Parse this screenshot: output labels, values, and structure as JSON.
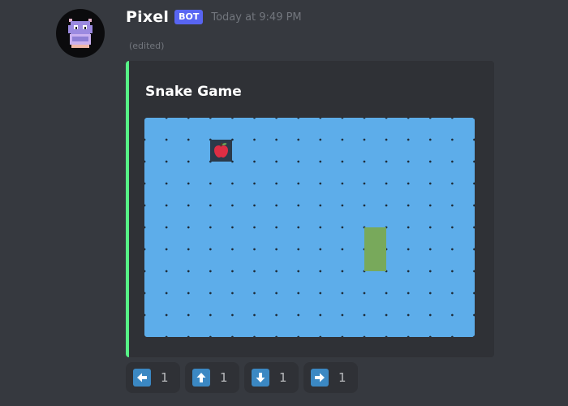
{
  "message": {
    "username": "Pixel",
    "bot_badge": "BOT",
    "timestamp": "Today at 9:49 PM",
    "edited": "(edited)",
    "avatar_icon": "pixel-monster-avatar"
  },
  "embed": {
    "accent_color": "#57f287",
    "title": "Snake Game",
    "board": {
      "columns": 15,
      "rows": 10,
      "background": "#5dadea",
      "apple": {
        "col": 3,
        "row": 1,
        "icon": "red-apple-icon"
      },
      "snake": [
        {
          "col": 10,
          "row": 5
        },
        {
          "col": 10,
          "row": 6
        }
      ],
      "snake_color": "#78a95b"
    }
  },
  "reactions": [
    {
      "icon": "left-arrow-icon",
      "count": "1"
    },
    {
      "icon": "up-arrow-icon",
      "count": "1"
    },
    {
      "icon": "down-arrow-icon",
      "count": "1"
    },
    {
      "icon": "right-arrow-icon",
      "count": "1"
    }
  ]
}
